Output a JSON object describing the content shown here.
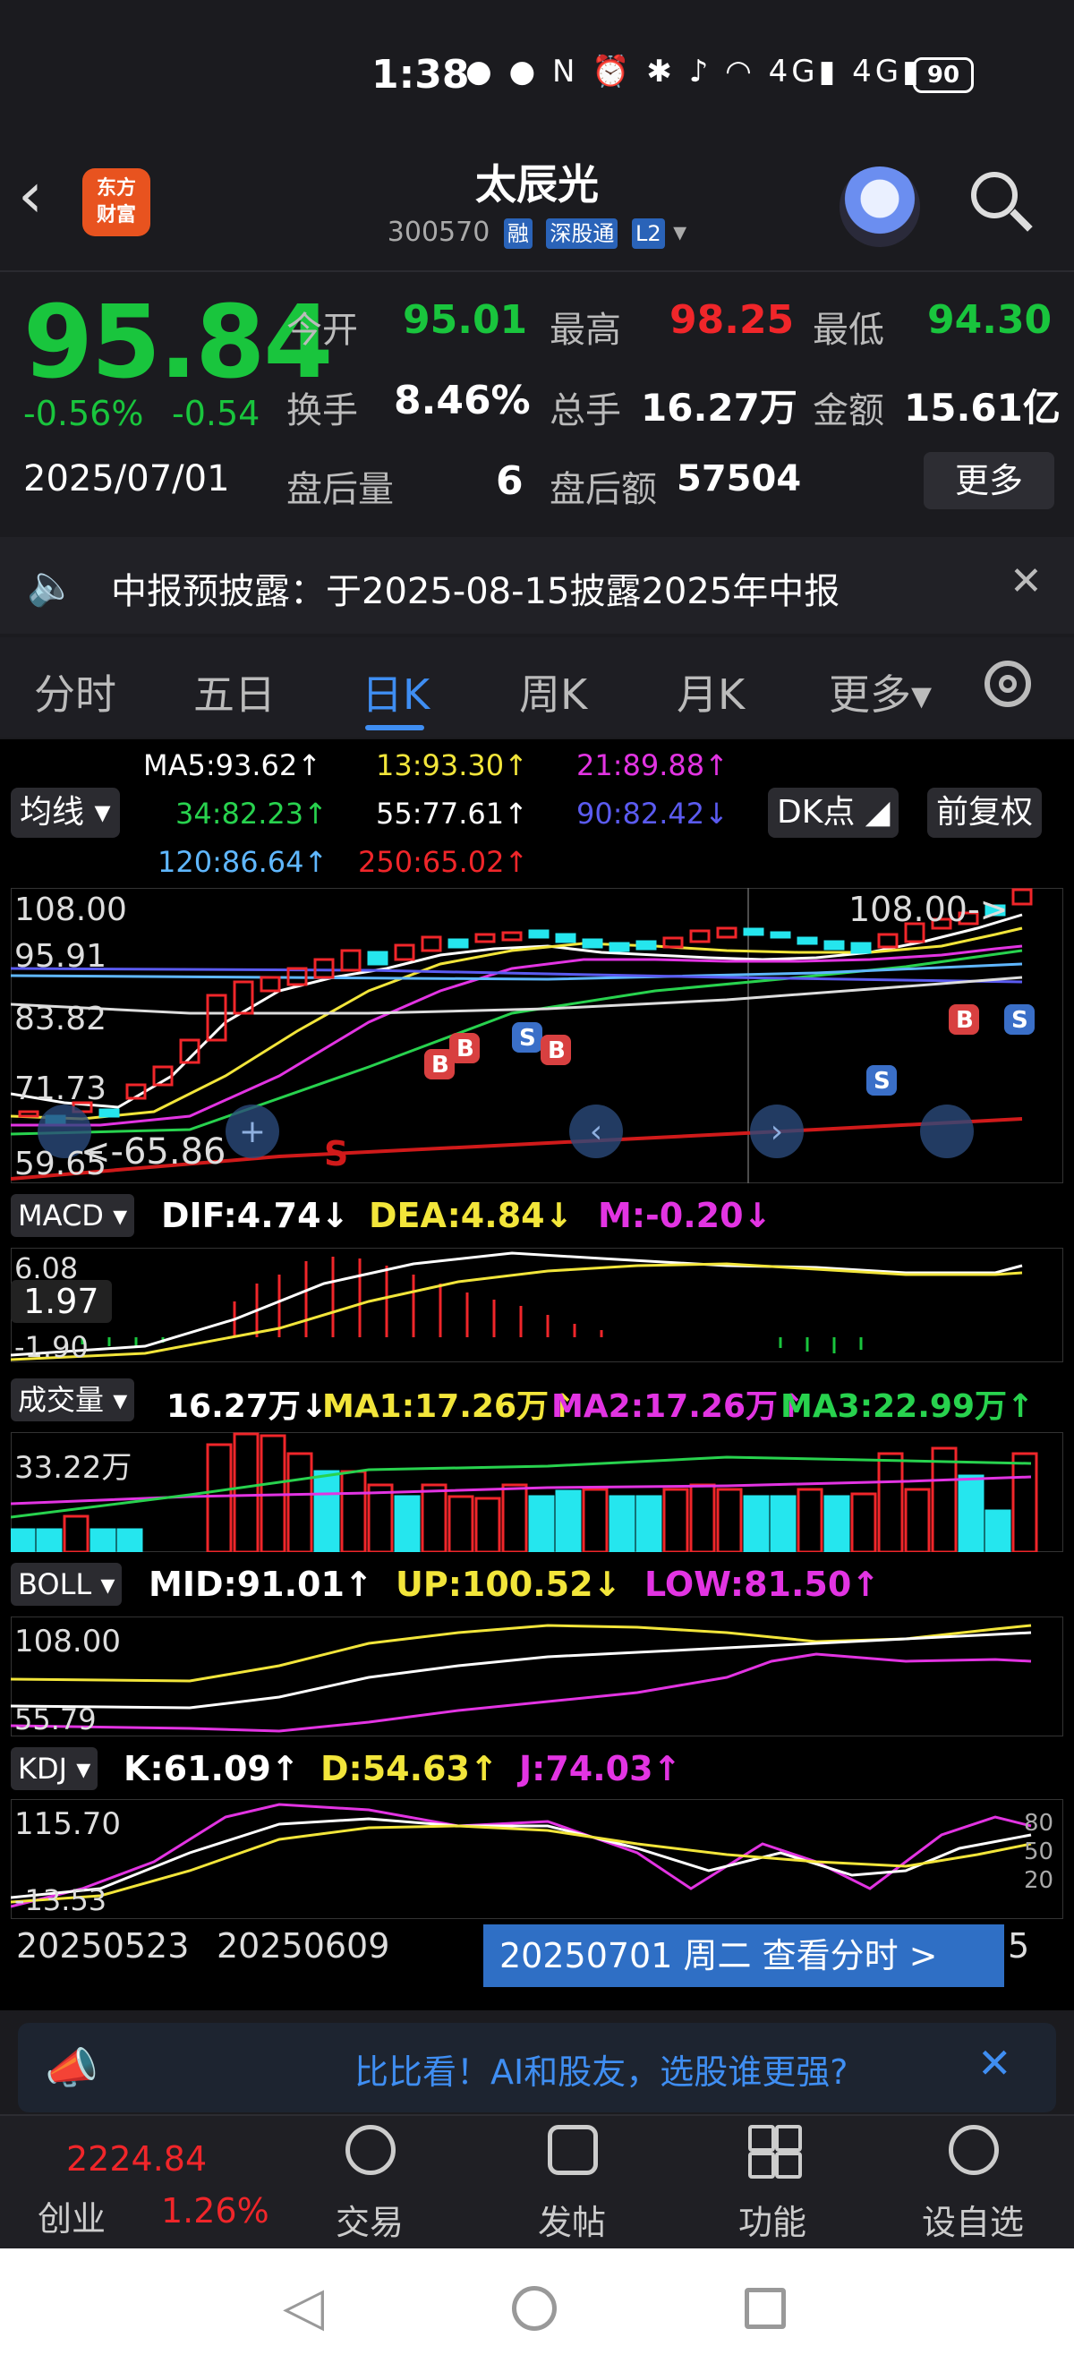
{
  "status_bar": {
    "time": "1:38",
    "battery": "90"
  },
  "header": {
    "app_logo": "东方\n财富",
    "title": "太辰光",
    "code": "300570",
    "tags": [
      "融",
      "深股通",
      "L2"
    ]
  },
  "quote": {
    "price": "95.84",
    "change_pct": "-0.56%",
    "change": "-0.54",
    "date": "2025/07/01",
    "open_label": "今开",
    "open": "95.01",
    "high_label": "最高",
    "high": "98.25",
    "low_label": "最低",
    "low": "94.30",
    "turnover_label": "换手",
    "turnover": "8.46%",
    "volume_label": "总手",
    "volume": "16.27万",
    "amount_label": "金额",
    "amount": "15.61亿",
    "after_vol_label": "盘后量",
    "after_vol": "6",
    "after_amt_label": "盘后额",
    "after_amt": "57504",
    "more": "更多"
  },
  "notice": {
    "text": "中报预披露：于2025-08-15披露2025年中报"
  },
  "tabs": [
    "分时",
    "五日",
    "日K",
    "周K",
    "月K",
    "更多▾"
  ],
  "ma_panel": {
    "selector": "均线",
    "dk_button": "DK点",
    "fq_button": "前复权",
    "ma5": "MA5:93.62↑",
    "ma13": "13:93.30↑",
    "ma21": "21:89.88↑",
    "ma34": "34:82.23↑",
    "ma55": "55:77.61↑",
    "ma90": "90:82.42↓",
    "ma120": "120:86.64↑",
    "ma250": "250:65.02↑"
  },
  "kline_axis": {
    "y1": "108.00",
    "y2": "95.91",
    "y3": "83.82",
    "y4": "71.73",
    "y5": "59.65",
    "max_note": "108.00->",
    "min_note": "<-65.86"
  },
  "macd": {
    "selector": "MACD",
    "dif": "DIF:4.74↓",
    "dea": "DEA:4.84↓",
    "m": "M:-0.20↓",
    "y_top": "6.08",
    "y_mid": "1.97",
    "y_bot": "-1.90"
  },
  "volume": {
    "selector": "成交量",
    "val": "16.27万↓",
    "ma1": "MA1:17.26万↑",
    "ma2": "MA2:17.26万↑",
    "ma3": "MA3:22.99万↑",
    "y_top": "33.22万"
  },
  "boll": {
    "selector": "BOLL",
    "mid": "MID:91.01↑",
    "up": "UP:100.52↓",
    "low": "LOW:81.50↑",
    "y_top": "108.00",
    "y_bot": "55.79"
  },
  "kdj": {
    "selector": "KDJ",
    "k": "K:61.09↑",
    "d": "D:54.63↑",
    "j": "J:74.03↑",
    "y_top": "115.70",
    "y_bot": "-13.53",
    "r80": "80",
    "r50": "50",
    "r20": "20"
  },
  "date_axis": {
    "d1": "20250523",
    "d2": "20250609",
    "d3": "5"
  },
  "tooltip": "20250701 周二 查看分时 >",
  "ad": "比比看！AI和股友，选股谁更强?",
  "bottom_nav": {
    "index_value": "2224.84",
    "index_name": "创业",
    "index_pct": "1.26%",
    "trade": "交易",
    "post": "发帖",
    "func": "功能",
    "watch": "设自选"
  },
  "colors": {
    "up": "#f0262a",
    "down": "#19c53d",
    "accent": "#3f8ef2"
  }
}
